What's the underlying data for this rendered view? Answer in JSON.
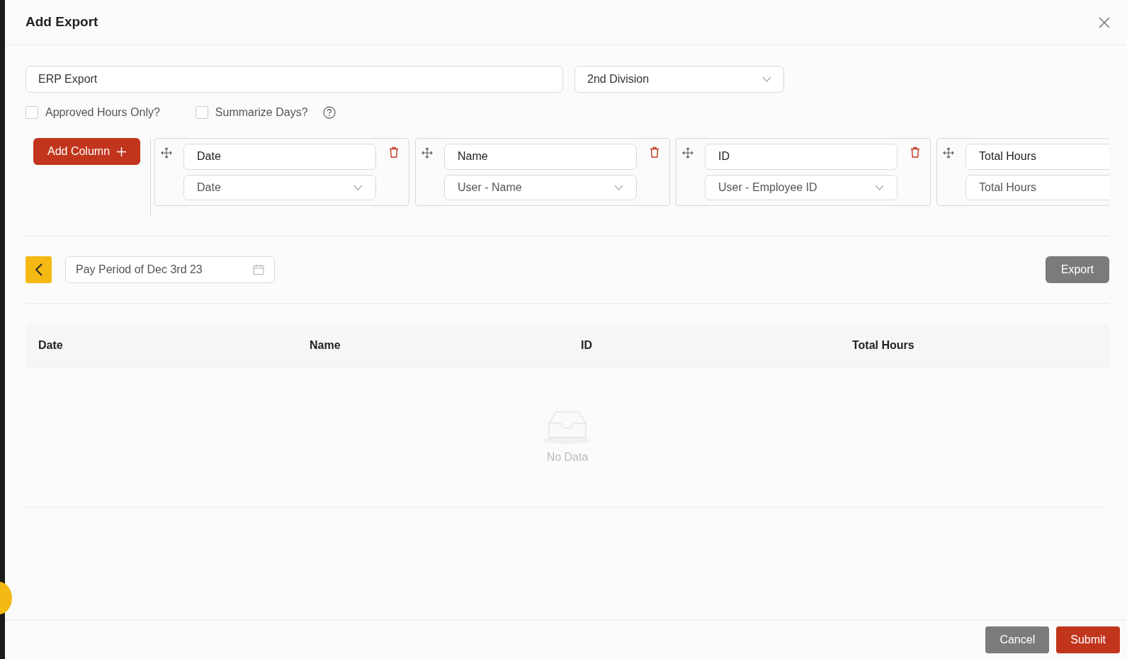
{
  "modal": {
    "title": "Add Export"
  },
  "form": {
    "export_name": "ERP Export",
    "division": "2nd Division",
    "options": [
      {
        "label": "Approved Hours Only?",
        "checked": false
      },
      {
        "label": "Summarize Days?",
        "checked": false,
        "help": true
      }
    ]
  },
  "add_column_button": "Add Column",
  "columns": [
    {
      "title": "Date",
      "source": "Date"
    },
    {
      "title": "Name",
      "source": "User - Name"
    },
    {
      "title": "ID",
      "source": "User - Employee ID"
    },
    {
      "title": "Total Hours",
      "source": "Total Hours"
    }
  ],
  "period": {
    "value": "Pay Period of Dec 3rd 23"
  },
  "export_button": "Export",
  "table": {
    "columns": [
      "Date",
      "Name",
      "ID",
      "Total Hours"
    ],
    "empty_text": "No Data"
  },
  "footer": {
    "buttons": [
      {
        "label": "Cancel",
        "kind": "secondary"
      },
      {
        "label": "Submit",
        "kind": "primary"
      }
    ]
  }
}
